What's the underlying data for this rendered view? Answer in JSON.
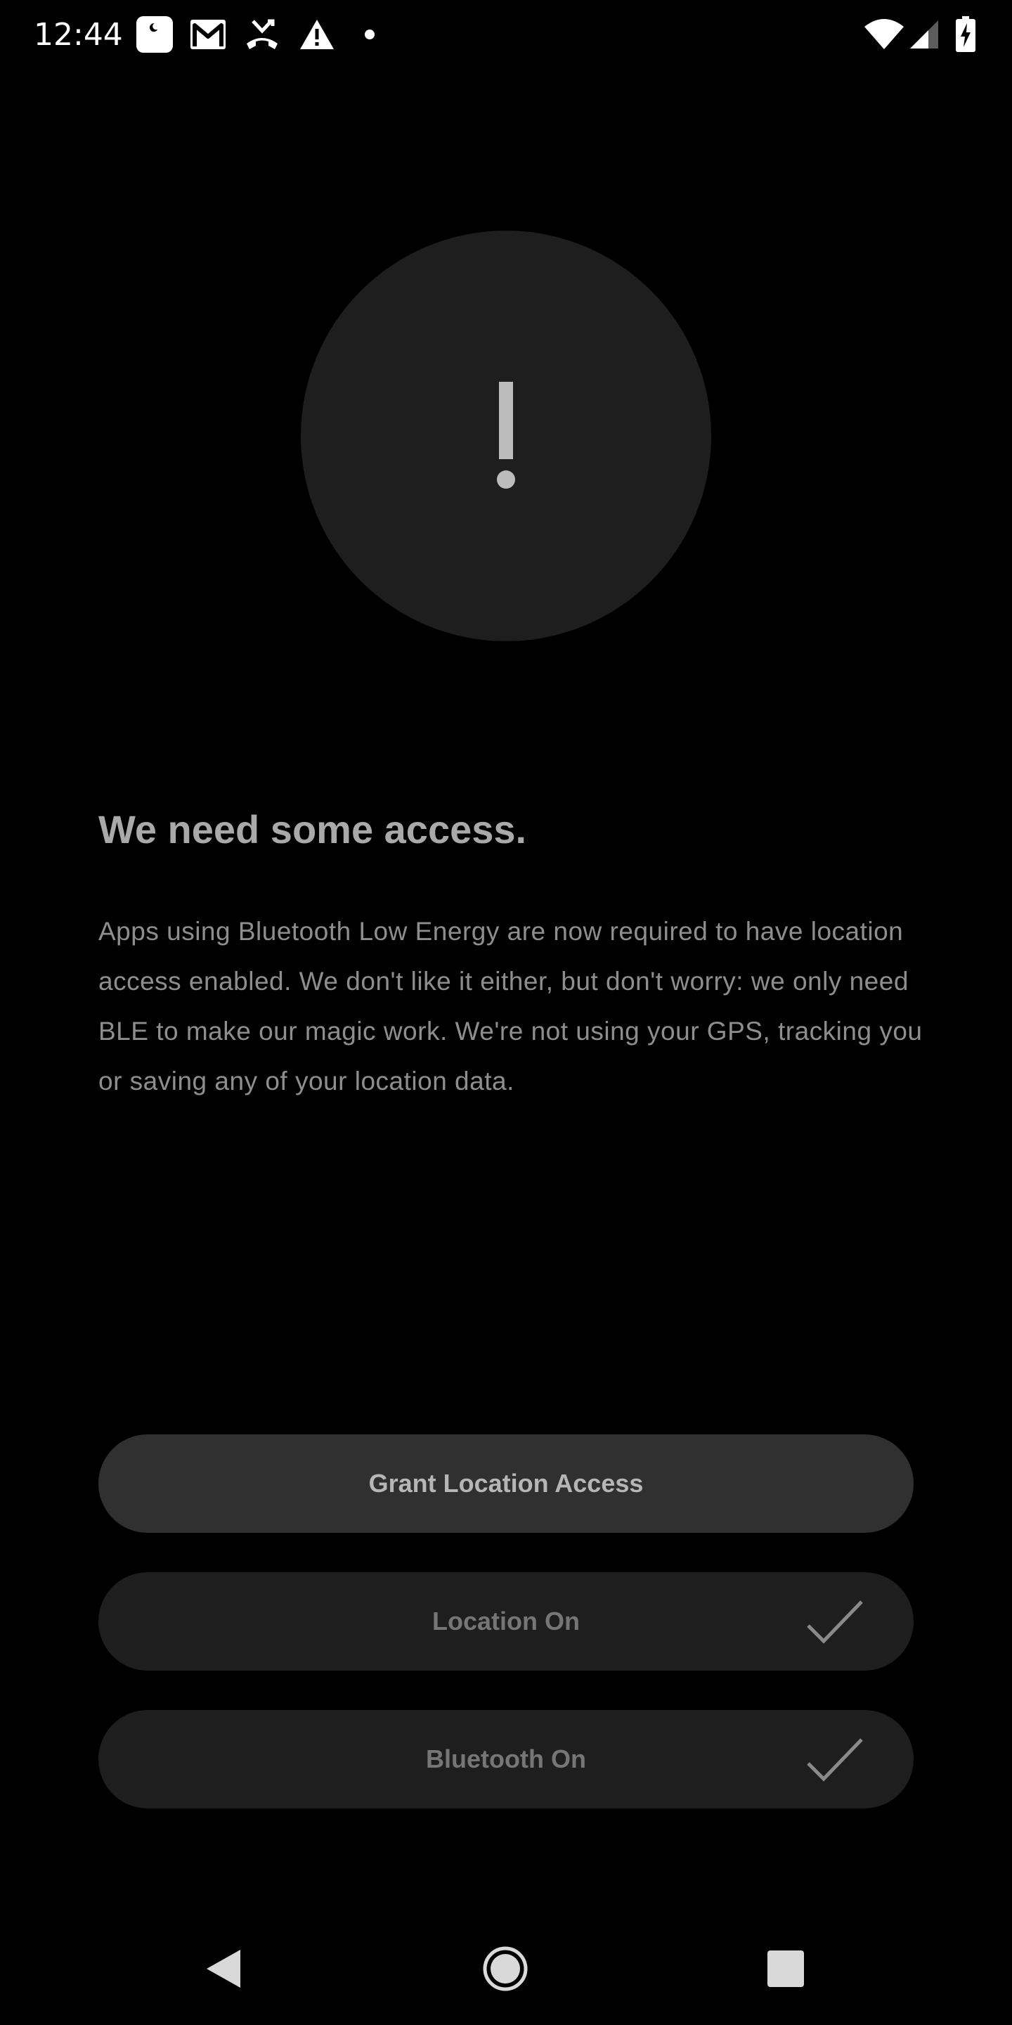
{
  "status_bar": {
    "time": "12:44",
    "left_icons": [
      "do-not-disturb-icon",
      "gmail-icon",
      "missed-call-icon",
      "warning-icon",
      "dot-icon"
    ],
    "right_icons": [
      "wifi-icon",
      "cellular-signal-icon",
      "battery-charging-icon"
    ]
  },
  "alert": {
    "icon": "exclamation-icon"
  },
  "content": {
    "title": "We need some access.",
    "description": "Apps using Bluetooth Low Energy are now required to have location access enabled. We don't like it either, but don't worry: we only need BLE to make our magic work. We're not using your GPS, tracking you or saving any of your location data."
  },
  "buttons": {
    "grant_location": "Grant Location Access",
    "location_on": "Location On",
    "bluetooth_on": "Bluetooth On"
  },
  "nav_bar": {
    "icons": [
      "back-icon",
      "home-icon",
      "recents-icon"
    ]
  },
  "colors": {
    "background": "#000000",
    "circle": "#1e1e1e",
    "primary_button": "#303030",
    "secondary_button": "#1e1e1e"
  }
}
